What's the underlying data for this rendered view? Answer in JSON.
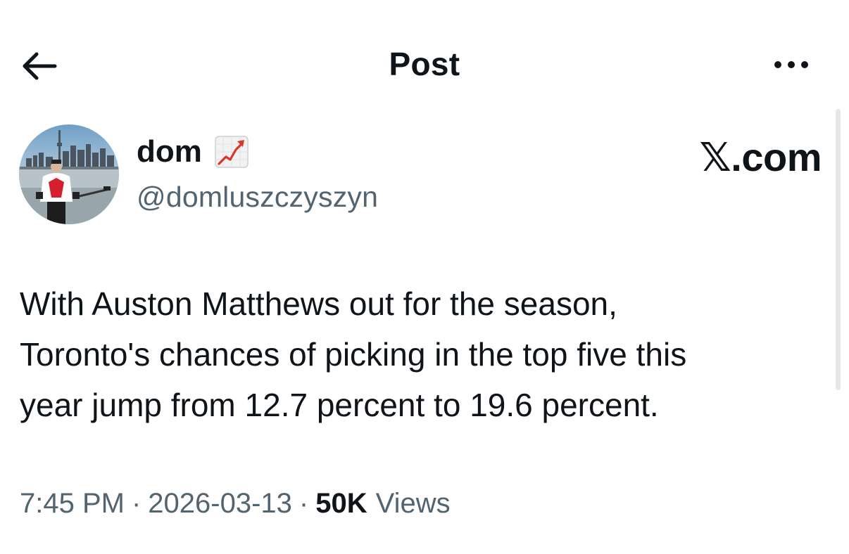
{
  "header": {
    "title": "Post",
    "back_icon": "arrow-left-icon",
    "more_icon": "more-horizontal-icon"
  },
  "author": {
    "display_name": "dom",
    "badge_icon": "chart-increasing-emoji-icon",
    "handle": "@domluszczyszyn"
  },
  "source_label": "𝕏.com",
  "post": {
    "text": "With Auston Matthews out for the season,\nToronto's chances of picking in the top five this\nyear jump from 12.7 percent to 19.6 percent."
  },
  "meta": {
    "time": "7:45 PM",
    "separator": "·",
    "date": "2026-03-13",
    "views_count": "50K",
    "views_label": "Views"
  },
  "colors": {
    "text_primary": "#0f1419",
    "text_secondary": "#536471",
    "background": "#ffffff"
  }
}
